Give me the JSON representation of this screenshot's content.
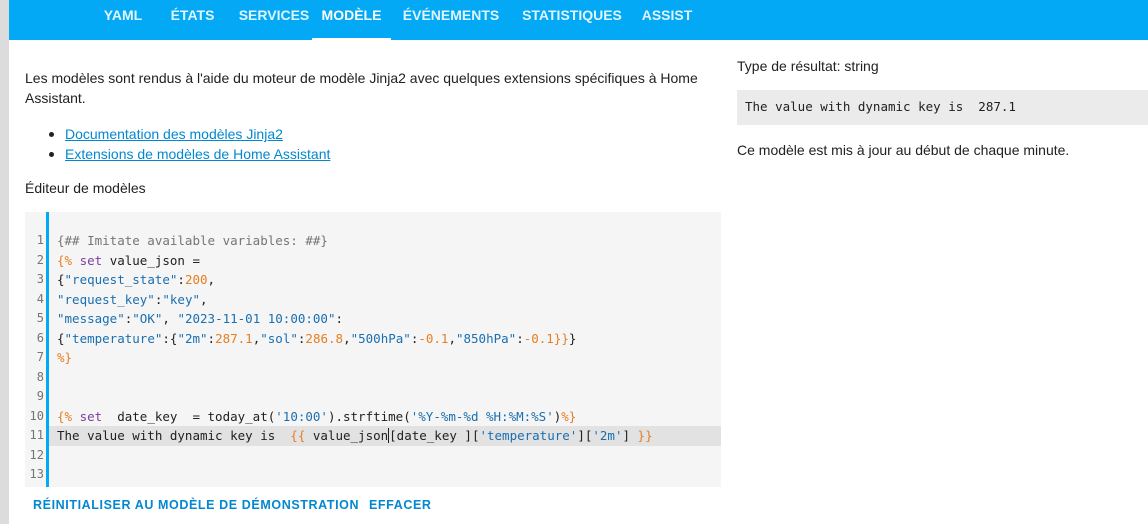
{
  "tabs": [
    {
      "label": "YAML"
    },
    {
      "label": "ÉTATS"
    },
    {
      "label": "SERVICES"
    },
    {
      "label": "MODÈLE",
      "active": true
    },
    {
      "label": "ÉVÉNEMENTS"
    },
    {
      "label": "STATISTIQUES"
    },
    {
      "label": "ASSIST"
    }
  ],
  "intro": "Les modèles sont rendus à l'aide du moteur de modèle Jinja2 avec quelques extensions spécifiques à Home Assistant.",
  "links": [
    {
      "label": "Documentation des modèles Jinja2"
    },
    {
      "label": "Extensions de modèles de Home Assistant"
    }
  ],
  "editor": {
    "label": "Éditeur de modèles",
    "line_numbers": [
      "1",
      "2",
      "3",
      "4",
      "5",
      "6",
      "7",
      "8",
      "9",
      "10",
      "11",
      "12",
      "13"
    ],
    "active_line": 11,
    "lines": [
      "{## Imitate available variables: ##}",
      "{% set value_json =",
      "{\"request_state\":200,",
      "\"request_key\":\"key\",",
      "\"message\":\"OK\", \"2023-11-01 10:00:00\":",
      "{\"temperature\":{\"2m\":287.1,\"sol\":286.8,\"500hPa\":-0.1,\"850hPa\":-0.1}}}",
      "%}",
      "",
      "",
      "{% set  date_key  = today_at('10:00').strftime('%Y-%m-%d %H:%M:%S')%}",
      "The value with dynamic key is  {{ value_json[date_key ]['temperature']['2m'] }}",
      "",
      ""
    ]
  },
  "actions": {
    "reset_label": "RÉINITIALISER AU MODÈLE DE DÉMONSTRATION",
    "clear_label": "EFFACER"
  },
  "result": {
    "type_label": "Type de résultat: string",
    "output": "The value with dynamic key is  287.1",
    "note": "Ce modèle est mis à jour au début de chaque minute."
  },
  "colors": {
    "accent": "#03a9f4",
    "link": "#0288d1"
  }
}
